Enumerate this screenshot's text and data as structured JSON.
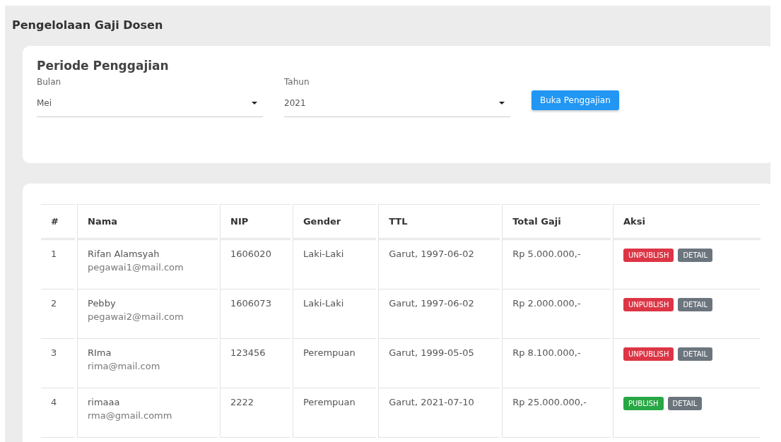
{
  "page_title": "Pengelolaan Gaji Dosen",
  "period": {
    "title": "Periode Penggajian",
    "month": {
      "label": "Bulan",
      "value": "Mei"
    },
    "year": {
      "label": "Tahun",
      "value": "2021"
    },
    "button": "Buka Penggajian"
  },
  "table": {
    "columns": [
      "#",
      "Nama",
      "NIP",
      "Gender",
      "TTL",
      "Total Gaji",
      "Aksi"
    ],
    "rows": [
      {
        "no": "1",
        "name": "Rifan Alamsyah",
        "email": "pegawai1@mail.com",
        "nip": "1606020",
        "gender": "Laki-Laki",
        "ttl": "Garut, 1997-06-02",
        "total": "Rp 5.000.000,-",
        "actions": [
          {
            "label": "UNPUBLISH",
            "kind": "unpublish"
          },
          {
            "label": "DETAIL",
            "kind": "detail"
          }
        ]
      },
      {
        "no": "2",
        "name": "Pebby",
        "email": "pegawai2@mail.com",
        "nip": "1606073",
        "gender": "Laki-Laki",
        "ttl": "Garut, 1997-06-02",
        "total": "Rp 2.000.000,-",
        "actions": [
          {
            "label": "UNPUBLISH",
            "kind": "unpublish"
          },
          {
            "label": "DETAIL",
            "kind": "detail"
          }
        ]
      },
      {
        "no": "3",
        "name": "RIma",
        "email": "rima@mail.com",
        "nip": "123456",
        "gender": "Perempuan",
        "ttl": "Garut, 1999-05-05",
        "total": "Rp 8.100.000,-",
        "actions": [
          {
            "label": "UNPUBLISH",
            "kind": "unpublish"
          },
          {
            "label": "DETAIL",
            "kind": "detail"
          }
        ]
      },
      {
        "no": "4",
        "name": "rimaaa",
        "email": "rma@gmail.comm",
        "nip": "2222",
        "gender": "Perempuan",
        "ttl": "Garut, 2021-07-10",
        "total": "Rp 25.000.000,-",
        "actions": [
          {
            "label": "PUBLISH",
            "kind": "publish"
          },
          {
            "label": "DETAIL",
            "kind": "detail"
          }
        ]
      }
    ]
  }
}
